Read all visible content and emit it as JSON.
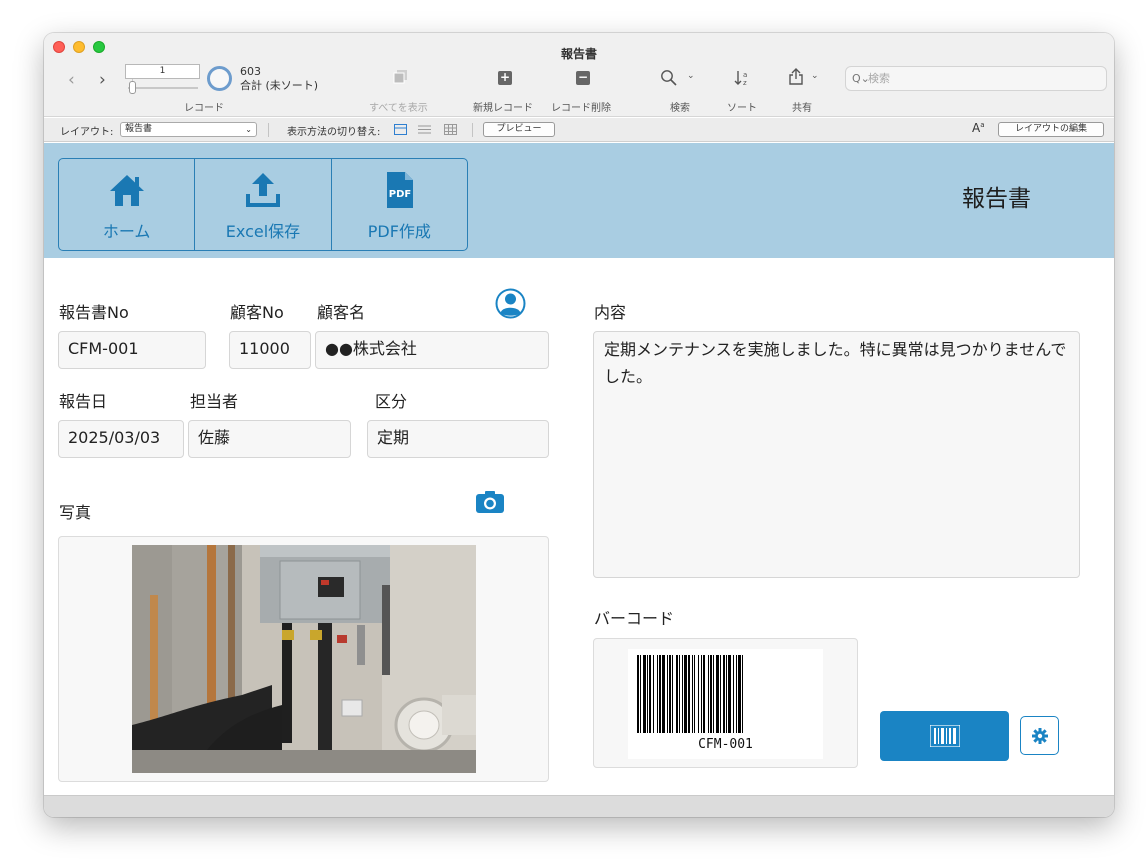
{
  "window": {
    "title": "報告書"
  },
  "toolbar": {
    "record_value": "1",
    "record_total": "603",
    "record_status": "合計 (未ソート)",
    "record_label": "レコード",
    "show_all": "すべてを表示",
    "new_record": "新規レコード",
    "delete_record": "レコード削除",
    "find": "検索",
    "sort": "ソート",
    "share": "共有",
    "search_placeholder": "検索"
  },
  "layoutbar": {
    "layout_label": "レイアウト:",
    "layout_value": "報告書",
    "view_switch_label": "表示方法の切り替え:",
    "preview": "プレビュー",
    "edit_layout": "レイアウトの編集"
  },
  "header": {
    "nav": [
      {
        "label": "ホーム",
        "icon": "home-icon"
      },
      {
        "label": "Excel保存",
        "icon": "upload-icon"
      },
      {
        "label": "PDF作成",
        "icon": "pdf-icon"
      }
    ],
    "title": "報告書"
  },
  "form": {
    "labels": {
      "report_no": "報告書No",
      "customer_no": "顧客No",
      "customer_name": "顧客名",
      "report_date": "報告日",
      "staff": "担当者",
      "category": "区分",
      "photo": "写真",
      "content": "内容",
      "barcode": "バーコード"
    },
    "values": {
      "report_no": "CFM-001",
      "customer_no": "11000",
      "customer_name": "●●株式会社",
      "report_date": "2025/03/03",
      "staff": "佐藤",
      "category": "定期",
      "content": "定期メンテナンスを実施しました。特に異常は見つかりませんでした。",
      "barcode_text": "CFM-001"
    }
  },
  "colors": {
    "accent": "#1a84c4",
    "header_bg": "#a9cde2"
  }
}
